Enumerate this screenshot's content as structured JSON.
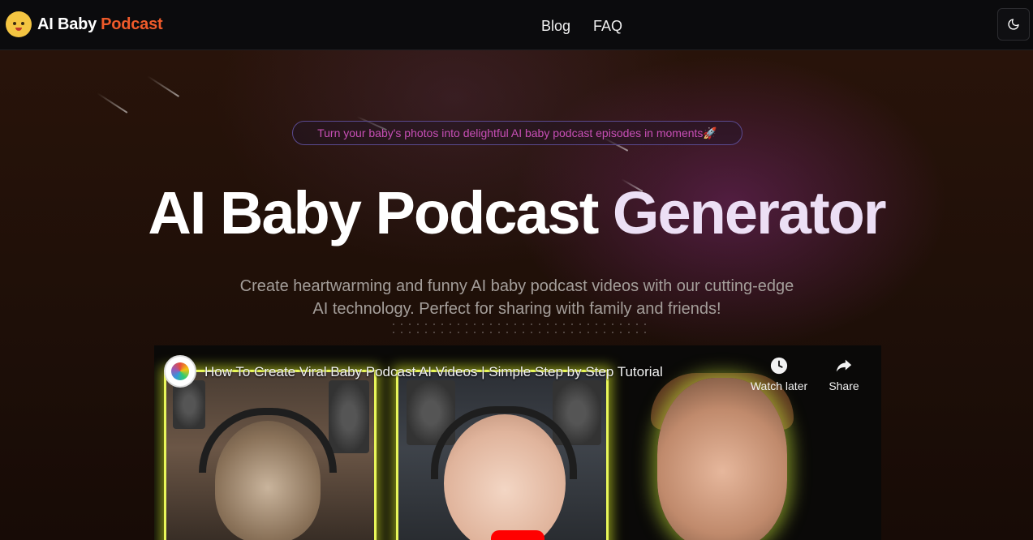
{
  "header": {
    "logo_text_part1": "AI Baby",
    "logo_text_part2": "Podcast",
    "logo_icon": "baby-face-icon",
    "nav": [
      "Blog",
      "FAQ"
    ],
    "theme_toggle_icon": "moon-icon"
  },
  "hero": {
    "pill_text": "Turn your baby's photos into delightful AI baby podcast episodes in moments🚀",
    "title_white": "AI Baby Podcast",
    "title_gradient": "Generator",
    "subtitle": "Create heartwarming and funny AI baby podcast videos with our cutting-edge AI technology. Perfect for sharing with family and friends!"
  },
  "video": {
    "title": "How To Create Viral Baby Podcast AI Videos | Simple Step by Step Tutorial",
    "watch_later_label": "Watch later",
    "share_label": "Share",
    "watch_later_icon": "clock-icon",
    "share_icon": "share-arrow-icon",
    "play_icon": "play-button-icon"
  },
  "colors": {
    "accent_orange": "#ef5a2a",
    "pill_text": "#c84fb6",
    "panel_glow": "#e8f65a"
  }
}
